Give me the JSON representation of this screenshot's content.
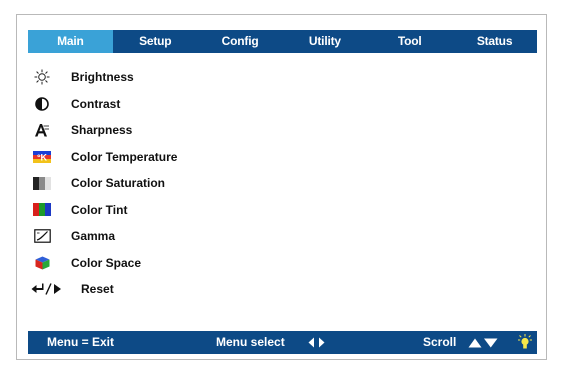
{
  "tabs": [
    {
      "label": "Main",
      "active": true
    },
    {
      "label": "Setup",
      "active": false
    },
    {
      "label": "Config",
      "active": false
    },
    {
      "label": "Utility",
      "active": false
    },
    {
      "label": "Tool",
      "active": false
    },
    {
      "label": "Status",
      "active": false
    }
  ],
  "menu": {
    "items": [
      {
        "label": "Brightness",
        "icon": "sun-icon"
      },
      {
        "label": "Contrast",
        "icon": "contrast-icon"
      },
      {
        "label": "Sharpness",
        "icon": "sharpness-icon"
      },
      {
        "label": "Color Temperature",
        "icon": "color-temperature-icon"
      },
      {
        "label": "Color Saturation",
        "icon": "color-saturation-icon"
      },
      {
        "label": "Color Tint",
        "icon": "color-tint-icon"
      },
      {
        "label": "Gamma",
        "icon": "gamma-icon"
      },
      {
        "label": "Color Space",
        "icon": "color-space-icon"
      },
      {
        "label": "Reset",
        "icon": "reset-icon"
      }
    ]
  },
  "footer": {
    "exit": "Menu = Exit",
    "select": "Menu select",
    "scroll": "Scroll"
  },
  "colors": {
    "bar": "#0d4a86",
    "active_tab": "#3aa2d7",
    "frame_border": "#b9b9b9"
  }
}
